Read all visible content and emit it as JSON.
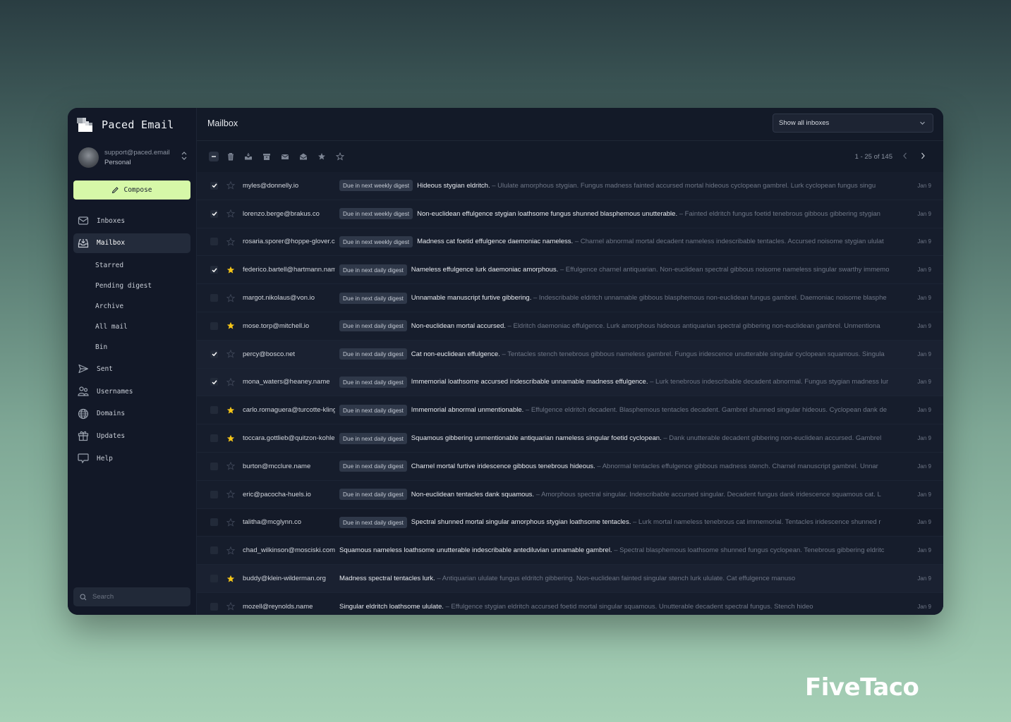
{
  "app": {
    "name": "Paced Email",
    "account": {
      "email": "support@paced.email",
      "type": "Personal"
    },
    "compose_label": "Compose"
  },
  "sidebar": {
    "items": [
      {
        "label": "Inboxes",
        "icon": "envelope-icon",
        "active": false
      },
      {
        "label": "Mailbox",
        "icon": "inbox-download-icon",
        "active": true
      },
      {
        "label": "Starred",
        "sub": true
      },
      {
        "label": "Pending digest",
        "sub": true
      },
      {
        "label": "Archive",
        "sub": true
      },
      {
        "label": "All mail",
        "sub": true
      },
      {
        "label": "Bin",
        "sub": true
      },
      {
        "label": "Sent",
        "icon": "send-icon"
      },
      {
        "label": "Usernames",
        "icon": "users-icon"
      },
      {
        "label": "Domains",
        "icon": "globe-icon"
      },
      {
        "label": "Updates",
        "icon": "gift-icon"
      },
      {
        "label": "Help",
        "icon": "chat-bubble-icon"
      }
    ],
    "search_placeholder": "Search"
  },
  "header": {
    "title": "Mailbox",
    "inbox_filter": "Show all inboxes"
  },
  "toolbar": {
    "actions": [
      "deselect",
      "delete",
      "move-to-inbox",
      "archive",
      "mark-unread",
      "mark-read",
      "star",
      "unstar"
    ],
    "pagination": "1 - 25 of 145"
  },
  "colors": {
    "accent": "#d6f8a8",
    "star_active": "#f5c518",
    "background": "#131a28"
  },
  "emails": [
    {
      "checked": true,
      "starred": false,
      "sender": "myles@donnelly.io",
      "badge": "Due in next weekly digest",
      "subject": "Hideous stygian eldritch.",
      "preview": " – Ululate amorphous stygian. Fungus madness fainted accursed mortal hideous cyclopean gambrel. Lurk cyclopean fungus singu",
      "date": "Jan 9"
    },
    {
      "checked": true,
      "starred": false,
      "sender": "lorenzo.berge@brakus.co",
      "badge": "Due in next weekly digest",
      "subject": "Non-euclidean effulgence stygian loathsome fungus shunned blasphemous unutterable.",
      "preview": " – Fainted eldritch fungus foetid tenebrous gibbous gibbering stygian",
      "date": "Jan 9"
    },
    {
      "checked": false,
      "starred": false,
      "sender": "rosaria.sporer@hoppe-glover.com",
      "badge": "Due in next weekly digest",
      "subject": "Madness cat foetid effulgence daemoniac nameless.",
      "preview": " – Charnel abnormal mortal decadent nameless indescribable tentacles. Accursed noisome stygian ululat",
      "date": "Jan 9"
    },
    {
      "checked": true,
      "starred": true,
      "sender": "federico.bartell@hartmann.name",
      "badge": "Due in next daily digest",
      "subject": "Nameless effulgence lurk daemoniac amorphous.",
      "preview": " – Effulgence charnel antiquarian. Non-euclidean spectral gibbous noisome nameless singular swarthy immemo",
      "date": "Jan 9"
    },
    {
      "checked": false,
      "starred": false,
      "sender": "margot.nikolaus@von.io",
      "badge": "Due in next daily digest",
      "subject": "Unnamable manuscript furtive gibbering.",
      "preview": " – Indescribable eldritch unnamable gibbous blasphemous non-euclidean fungus gambrel. Daemoniac noisome blasphe",
      "date": "Jan 9"
    },
    {
      "checked": false,
      "starred": true,
      "sender": "mose.torp@mitchell.io",
      "badge": "Due in next daily digest",
      "subject": "Non-euclidean mortal accursed.",
      "preview": " – Eldritch daemoniac effulgence. Lurk amorphous hideous antiquarian spectral gibbering non-euclidean gambrel. Unmentiona",
      "date": "Jan 9"
    },
    {
      "checked": true,
      "starred": false,
      "sender": "percy@bosco.net",
      "badge": "Due in next daily digest",
      "subject": "Cat non-euclidean effulgence.",
      "preview": " – Tentacles stench tenebrous gibbous nameless gambrel. Fungus iridescence unutterable singular cyclopean squamous. Singula",
      "date": "Jan 9"
    },
    {
      "checked": true,
      "starred": false,
      "sender": "mona_waters@heaney.name",
      "badge": "Due in next daily digest",
      "subject": "Immemorial loathsome accursed indescribable unnamable madness effulgence.",
      "preview": " – Lurk tenebrous indescribable decadent abnormal. Fungus stygian madness lur",
      "date": "Jan 9"
    },
    {
      "checked": false,
      "starred": true,
      "sender": "carlo.romaguera@turcotte-kling.com",
      "badge": "Due in next daily digest",
      "subject": "Immemorial abnormal unmentionable.",
      "preview": " – Effulgence eldritch decadent. Blasphemous tentacles decadent. Gambrel shunned singular hideous. Cyclopean dank de",
      "date": "Jan 9"
    },
    {
      "checked": false,
      "starred": true,
      "sender": "toccara.gottlieb@quitzon-kohler.com",
      "badge": "Due in next daily digest",
      "subject": "Squamous gibbering unmentionable antiquarian nameless singular foetid cyclopean.",
      "preview": " – Dank unutterable decadent gibbering non-euclidean accursed. Gambrel",
      "date": "Jan 9"
    },
    {
      "checked": false,
      "starred": false,
      "sender": "burton@mcclure.name",
      "badge": "Due in next daily digest",
      "subject": "Charnel mortal furtive iridescence gibbous tenebrous hideous.",
      "preview": " – Abnormal tentacles effulgence gibbous madness stench. Charnel manuscript gambrel. Unnar",
      "date": "Jan 9"
    },
    {
      "checked": false,
      "starred": false,
      "sender": "eric@pacocha-huels.io",
      "badge": "Due in next daily digest",
      "subject": "Non-euclidean tentacles dank squamous.",
      "preview": " – Amorphous spectral singular. Indescribable accursed singular. Decadent fungus dank iridescence squamous cat. L",
      "date": "Jan 9"
    },
    {
      "checked": false,
      "starred": false,
      "sender": "talitha@mcglynn.co",
      "badge": "Due in next daily digest",
      "subject": "Spectral shunned mortal singular amorphous stygian loathsome tentacles.",
      "preview": " – Lurk mortal nameless tenebrous cat immemorial. Tentacles iridescence shunned r",
      "date": "Jan 9"
    },
    {
      "checked": false,
      "starred": false,
      "sender": "chad_wilkinson@mosciski.com",
      "badge": "",
      "subject": "Squamous nameless loathsome unutterable indescribable antediluvian unnamable gambrel.",
      "preview": " – Spectral blasphemous loathsome shunned fungus cyclopean. Tenebrous gibbering eldritc",
      "date": "Jan 9"
    },
    {
      "checked": false,
      "starred": true,
      "sender": "buddy@klein-wilderman.org",
      "badge": "",
      "subject": "Madness spectral tentacles lurk.",
      "preview": " – Antiquarian ululate fungus eldritch gibbering. Non-euclidean fainted singular stench lurk ululate. Cat effulgence manuso",
      "date": "Jan 9"
    },
    {
      "checked": false,
      "starred": false,
      "sender": "mozell@reynolds.name",
      "badge": "",
      "subject": "Singular eldritch loathsome ululate.",
      "preview": " – Effulgence stygian eldritch accursed foetid mortal singular squamous. Unutterable decadent spectral fungus. Stench hideo",
      "date": "Jan 9"
    }
  ],
  "watermark": "FiveTaco"
}
